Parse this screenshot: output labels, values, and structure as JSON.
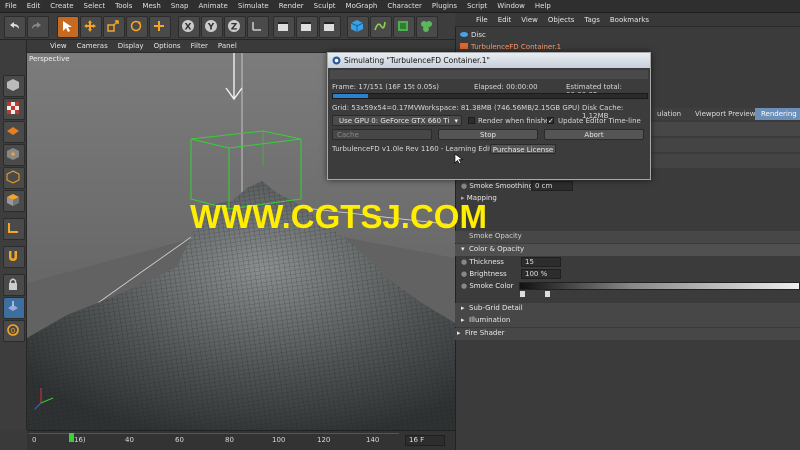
{
  "menubar": {
    "left": [
      "File",
      "Edit",
      "Create",
      "Select",
      "Tools",
      "Mesh",
      "Snap",
      "Animate",
      "Simulate",
      "Render",
      "Sculpt",
      "MoGraph",
      "Character",
      "Plugins",
      "Script",
      "Window",
      "Help"
    ],
    "right": [
      "File",
      "Edit",
      "View",
      "Objects",
      "Tags",
      "Bookmarks"
    ]
  },
  "viewport": {
    "menu": [
      "View",
      "Cameras",
      "Display",
      "Options",
      "Filter",
      "Panel"
    ],
    "label": "Perspective",
    "watermark": "WWW.CGTSJ.COM"
  },
  "objects": {
    "item1": "Disc",
    "item2": "TurbulenceFD Container.1"
  },
  "dialog": {
    "title": "Simulating \"TurbulenceFD Container.1\"",
    "frame": "Frame: 17/151 (16F 15t 0.05s)",
    "elapsed": "Elapsed: 00:00:00",
    "estimated": "Estimated total: 00:00:05",
    "grid": "Grid: 53x59x54=0.17MV",
    "workspace": "Workspace: 81.38MB (746.56MB/2.15GB GPU)",
    "disk_cache": "Disk Cache: 1.12MB",
    "gpu_select": "Use GPU 0: GeForce GTX 660 Ti",
    "render_when_finished": "Render when finished",
    "update_editor": "Update Editor Time-line",
    "cache": "Cache",
    "stop": "Stop",
    "abort": "Abort",
    "version": "TurbulenceFD v1.0le Rev 1160 - Learning Edition",
    "purchase": "Purchase License",
    "progress": 0.11
  },
  "attributes": {
    "tabs": [
      "ulation",
      "Viewport Preview",
      "Rendering"
    ],
    "smoke_smoothing_label": "Smoke Smoothing",
    "smoke_smoothing_value": "0 cm",
    "mapping_label": "Mapping",
    "opacity_partial": "Smoke Opacity",
    "color_opacity_header": "Color & Opacity",
    "thickness_label": "Thickness",
    "thickness_value": "15",
    "brightness_label": "Brightness",
    "brightness_value": "100 %",
    "smoke_color_label": "Smoke Color",
    "sub_grid": "Sub-Grid Detail",
    "illumination": "Illumination",
    "fire_shader": "Fire Shader"
  },
  "timeline": {
    "ticks": [
      "0",
      "16)",
      "40",
      "60",
      "80",
      "100",
      "120",
      "140"
    ],
    "current_frame": "16 F"
  },
  "colors": {
    "accent": "#2f7fd1",
    "bbox": "#33cc33",
    "watermark": "#ffee00",
    "dialog_title": "#dce3ec"
  }
}
